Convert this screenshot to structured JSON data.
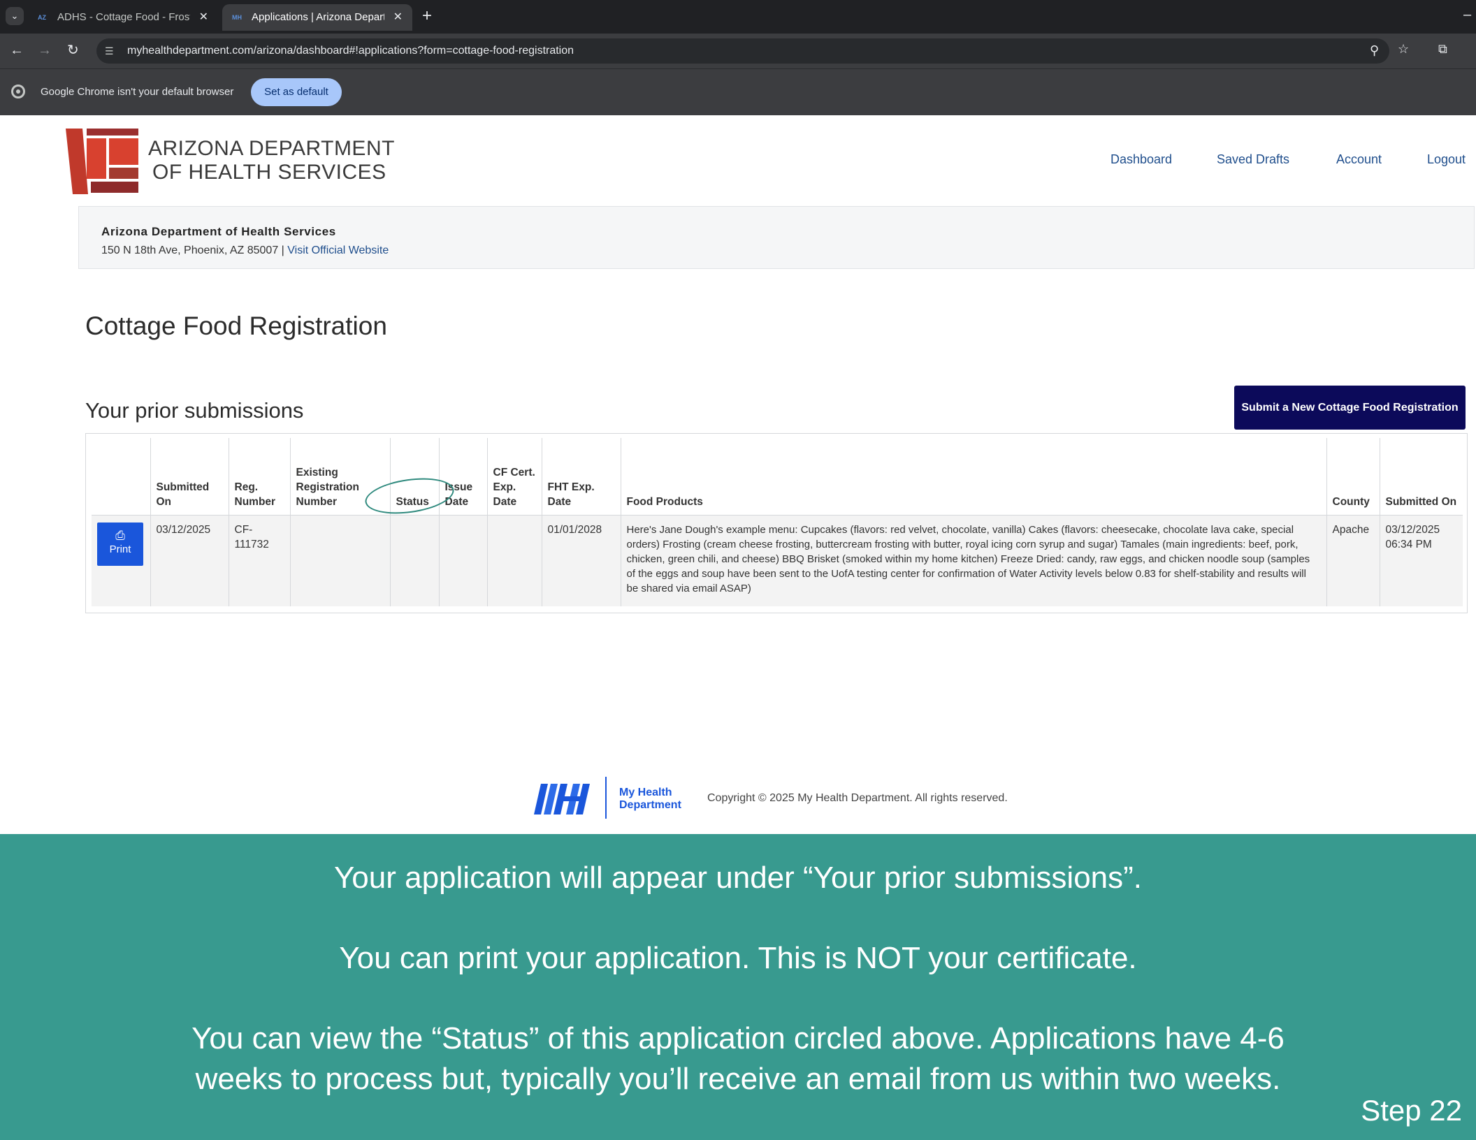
{
  "browser": {
    "tabs": [
      {
        "title": "ADHS - Cottage Food - Frosting",
        "favicon": "AZ",
        "active": false
      },
      {
        "title": "Applications | Arizona Departm",
        "favicon": "MH",
        "active": true
      }
    ],
    "url": "myhealthdepartment.com/arizona/dashboard#!applications?form=cottage-food-registration",
    "infobar_text": "Google Chrome isn't your default browser",
    "set_default_label": "Set as default"
  },
  "header": {
    "logo_line1": "ARIZONA DEPARTMENT",
    "logo_line2": "OF HEALTH SERVICES",
    "nav": [
      "Dashboard",
      "Saved Drafts",
      "Account",
      "Logout"
    ]
  },
  "department": {
    "name": "Arizona Department of Health Services",
    "address": "150 N 18th Ave, Phoenix, AZ 85007 |",
    "website_link": "Visit Official Website"
  },
  "page_title": "Cottage Food Registration",
  "submissions": {
    "heading": "Your prior submissions",
    "new_button_label": "Submit a New Cottage Food Registration",
    "columns": [
      "",
      "Submitted On",
      "Reg. Number",
      "Existing Registration Number",
      "Status",
      "Issue Date",
      "CF Cert. Exp. Date",
      "FHT Exp. Date",
      "Food Products",
      "County",
      "Submitted On"
    ],
    "rows": [
      {
        "print_label": "Print",
        "submitted_on": "03/12/2025",
        "reg_number": "CF-111732",
        "existing_reg_number": "",
        "status": "",
        "issue_date": "",
        "cf_cert_exp": "",
        "fht_exp": "01/01/2028",
        "food_products": "Here's Jane Dough's example menu: Cupcakes (flavors: red velvet, chocolate, vanilla) Cakes (flavors: cheesecake, chocolate lava cake, special orders) Frosting (cream cheese frosting, buttercream frosting with butter, royal icing corn syrup and sugar) Tamales (main ingredients: beef, pork, chicken, green chili, and cheese) BBQ Brisket (smoked within my home kitchen) Freeze Dried: candy, raw eggs, and chicken noodle soup (samples of the eggs and soup have been sent to the UofA testing center for confirmation of Water Activity levels below 0.83 for shelf-stability and results will be shared via email ASAP)",
        "county": "Apache",
        "submitted_on_datetime": "03/12/2025 06:34 PM"
      }
    ]
  },
  "footer": {
    "brand_line1": "My Health",
    "brand_line2": "Department",
    "copyright": "Copyright © 2025 My Health Department. All rights reserved."
  },
  "instructions": {
    "line1": "Your application will appear under “Your prior submissions”.",
    "line2": "You can print your application. This is NOT your certificate.",
    "line3": "You can view the “Status” of this application circled above. Applications have 4-6",
    "line4": "weeks to process but, typically you’ll receive an email from us within two weeks.",
    "step": "Step 22"
  },
  "colors": {
    "banner": "#389a8f",
    "submit_button": "#0c0a5a",
    "print_button": "#1a56db",
    "link": "#1f4e8c"
  }
}
